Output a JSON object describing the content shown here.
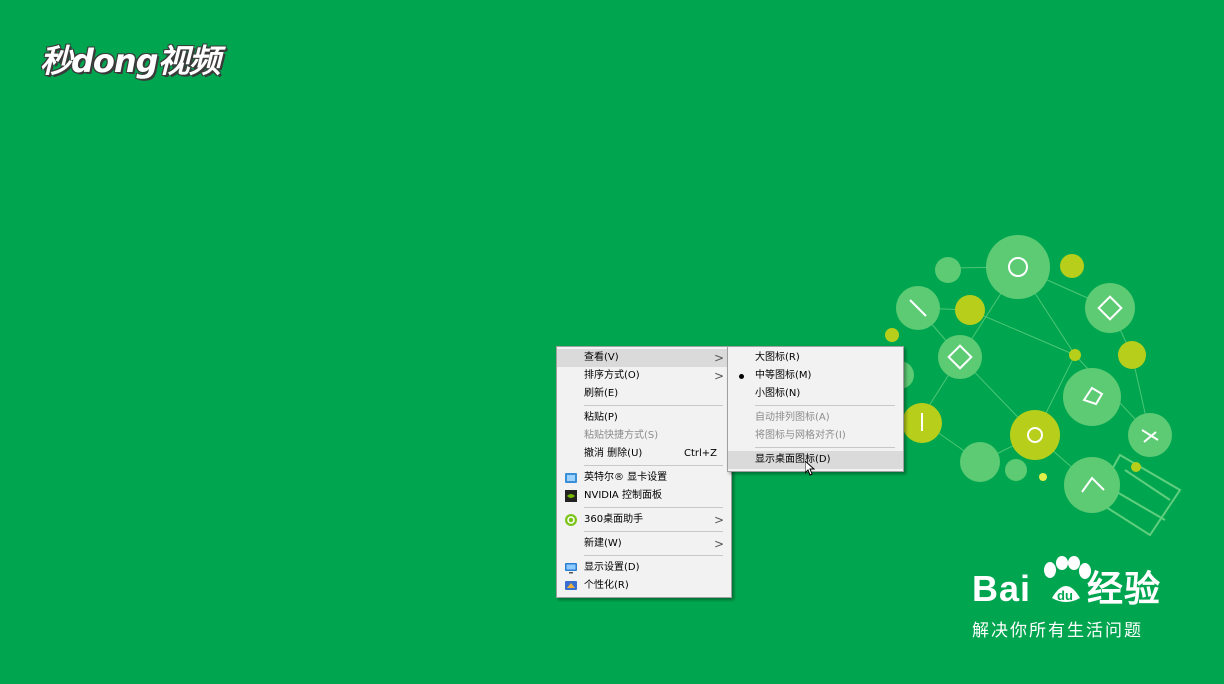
{
  "logo": {
    "text": "秒dong视频"
  },
  "context_menu": {
    "items": [
      {
        "label": "查看(V)",
        "submenu": true,
        "highlighted": true
      },
      {
        "label": "排序方式(O)",
        "submenu": true
      },
      {
        "label": "刷新(E)"
      },
      {
        "label": "粘贴(P)"
      },
      {
        "label": "粘贴快捷方式(S)",
        "disabled": true
      },
      {
        "label": "撤消 删除(U)",
        "shortcut": "Ctrl+Z"
      },
      {
        "label": "英特尔® 显卡设置",
        "icon": "intel-graphics-icon"
      },
      {
        "label": "NVIDIA 控制面板",
        "icon": "nvidia-icon"
      },
      {
        "label": "360桌面助手",
        "icon": "360-icon",
        "submenu": true
      },
      {
        "label": "新建(W)",
        "submenu": true
      },
      {
        "label": "显示设置(D)",
        "icon": "display-icon"
      },
      {
        "label": "个性化(R)",
        "icon": "personalize-icon"
      }
    ]
  },
  "view_submenu": {
    "items": [
      {
        "label": "大图标(R)"
      },
      {
        "label": "中等图标(M)",
        "selected": true
      },
      {
        "label": "小图标(N)"
      },
      {
        "label": "自动排列图标(A)",
        "disabled": true
      },
      {
        "label": "将图标与网格对齐(I)",
        "disabled": true
      },
      {
        "label": "显示桌面图标(D)",
        "highlighted": true
      }
    ]
  },
  "baidu": {
    "brand": "Bai",
    "brand2": "经验",
    "slogan": "解决你所有生活问题"
  },
  "colors": {
    "background": "#00a64f",
    "menu_bg": "#f2f2f2",
    "highlight": "#dadada"
  }
}
